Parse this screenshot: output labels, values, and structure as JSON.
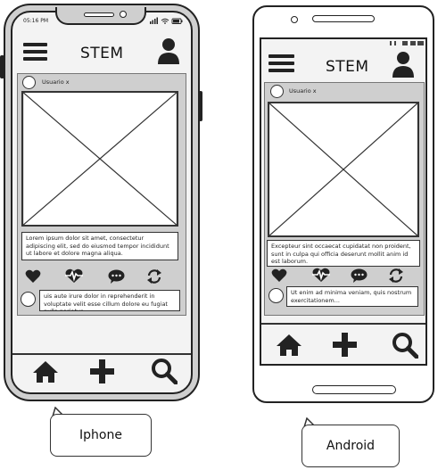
{
  "iphone": {
    "status_time": "05:16 PM",
    "app_title": "STEM",
    "post_user": "Usuario x",
    "post_text": "Lorem ipsum dolor sit amet, consectetur adipiscing elit, sed do eiusmod tempor incididunt ut labore et dolore magna aliqua.",
    "comment_text": "uis aute irure dolor in reprehenderit in voluptate velit esse cillum dolore eu fugiat nulla pariatur.",
    "label": "Iphone"
  },
  "android": {
    "app_title": "STEM",
    "post_user": "Usuario x",
    "post_text": "Excepteur sint occaecat cupidatat non proident, sunt in culpa qui officia deserunt mollit anim id est laborum.",
    "comment_text": "Ut enim ad minima veniam, quis nostrum exercitationem...",
    "label": "Android"
  },
  "icons": [
    "hamburger-menu-icon",
    "user-profile-icon",
    "heart-icon",
    "heartbeat-icon",
    "chat-bubble-icon",
    "refresh-icon",
    "home-icon",
    "plus-icon",
    "search-icon"
  ]
}
